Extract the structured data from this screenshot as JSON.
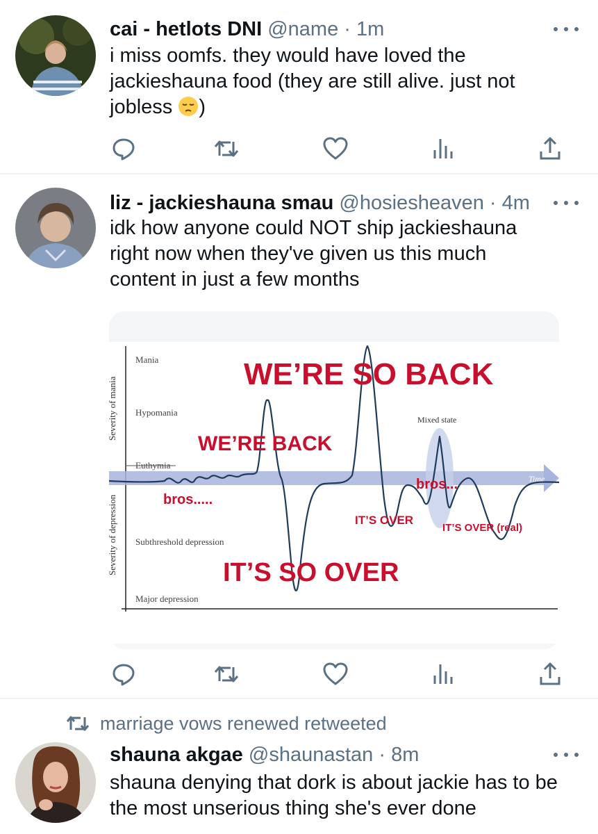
{
  "tweets": [
    {
      "name": "cai - hetlots DNI",
      "handle": "@name",
      "time": "· 1m",
      "text_before_emoji": "i miss oomfs. they would have loved the jackieshauna food (they are still alive. just not jobless ",
      "emoji": "pensive-face-emoji",
      "text_after_emoji": ")"
    },
    {
      "name": "liz - jackieshauna smau",
      "handle": "@hosiesheaven",
      "time": "· 4m",
      "text": "idk how anyone could NOT ship jackieshauna right now when they've given us this much content in just a few months"
    },
    {
      "retweet_label": "marriage vows renewed retweeted",
      "name": "shauna akgae",
      "handle": "@shaunastan",
      "time": "· 8m",
      "text": "shauna denying that dork is about jackie has to be the most unserious thing she's ever done"
    }
  ],
  "meme": {
    "y_axis_upper": "Severity of mania",
    "y_axis_lower": "Severity of depression",
    "levels": [
      "Mania",
      "Hypomania",
      "Euthymia",
      "Subthreshold depression",
      "Major depression"
    ],
    "time_label": "Time",
    "mixed_state": "Mixed state",
    "captions": {
      "so_back": "WE’RE SO BACK",
      "back": "WE’RE BACK",
      "bros1": "bros.....",
      "bros2": "bros...",
      "over": "IT’S OVER",
      "over_real": "IT’S OVER (real)",
      "so_over": "IT’S SO OVER"
    }
  },
  "icons": [
    "reply-icon",
    "retweet-icon",
    "like-icon",
    "analytics-icon",
    "share-icon",
    "more-icon"
  ],
  "colors": {
    "text": "#0f1419",
    "secondary": "#5b7083",
    "meme_red": "#c8102e",
    "meme_curve": "#1f3b5c",
    "time_band": "#a7b4dc"
  }
}
